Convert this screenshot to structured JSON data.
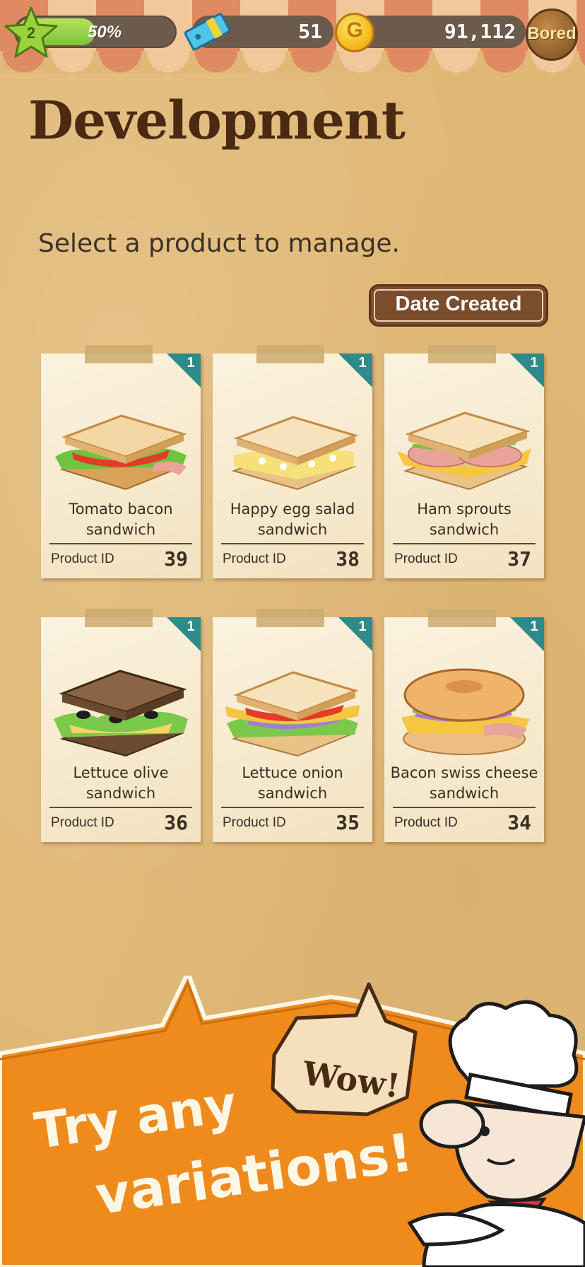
{
  "hud": {
    "level": "2",
    "xp_percent_label": "50%",
    "xp_fraction": 0.5,
    "tickets": "51",
    "coin_symbol": "G",
    "coins": "91,112",
    "mood": "Bored"
  },
  "page": {
    "title": "Development",
    "subtitle": "Select a product to manage.",
    "sort_label": "Date Created"
  },
  "products": [
    {
      "name": "Tomato bacon sandwich",
      "id_label": "Product ID",
      "id": "39",
      "badge": "1"
    },
    {
      "name": "Happy egg salad sandwich",
      "id_label": "Product ID",
      "id": "38",
      "badge": "1"
    },
    {
      "name": "Ham sprouts sandwich",
      "id_label": "Product ID",
      "id": "37",
      "badge": "1"
    },
    {
      "name": "Lettuce olive sandwich",
      "id_label": "Product ID",
      "id": "36",
      "badge": "1"
    },
    {
      "name": "Lettuce onion sandwich",
      "id_label": "Product ID",
      "id": "35",
      "badge": "1"
    },
    {
      "name": "Bacon swiss cheese sandwich",
      "id_label": "Product ID",
      "id": "34",
      "badge": "1"
    }
  ],
  "promo": {
    "line1": "Try any",
    "line2": "variations!",
    "bubble": "Wow!"
  },
  "colors": {
    "background": "#e1b977",
    "banner": "#ef8a1c",
    "corner_badge": "#2f8a8a",
    "title": "#4a2a12"
  }
}
